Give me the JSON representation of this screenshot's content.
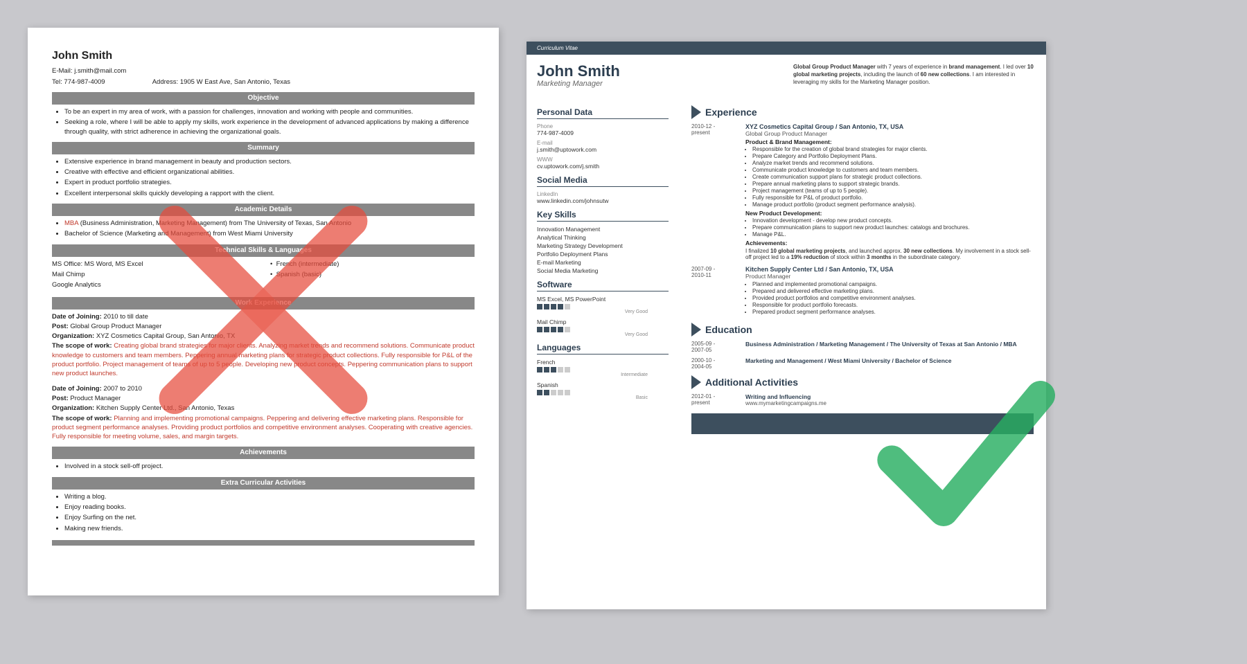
{
  "left_resume": {
    "name": "John Smith",
    "email": "E-Mail: j.smith@mail.com",
    "tel": "Tel: 774-987-4009",
    "address": "Address: 1905 W East Ave, San Antonio, Texas",
    "objective_header": "Objective",
    "objective_items": [
      "To be an expert in my area of work, with a passion for challenges, innovation and working with people and communities.",
      "Seeking a role, where I will be able to apply my skills, work experience in the development of advanced applications by making a difference through quality, with strict adherence in achieving the organizational goals."
    ],
    "summary_header": "Summary",
    "summary_items": [
      "Extensive experience in brand management in beauty and production sectors.",
      "Creative with effective and efficient organizational abilities.",
      "Expert in product portfolio strategies.",
      "Excellent interpersonal skills quickly developing a rapport with the client."
    ],
    "academic_header": "Academic Details",
    "academic_items": [
      "MBA (Business Administration, Marketing Management) from The University of Texas, San Antonio",
      "Bachelor of Science (Marketing and Management) from West Miami University"
    ],
    "technical_header": "Technical Skills & Languages",
    "technical_items": [
      "MS Office: MS Word, MS Excel",
      "Mail Chimp",
      "Google Analytics"
    ],
    "lang_items": [
      "French (intermediate)",
      "Spanish (basic)"
    ],
    "work_header": "Work Experience",
    "work_entries": [
      {
        "date": "Date of Joining: 2010 to till date",
        "post": "Post: Global Group Product Manager",
        "org": "Organization: XYZ Cosmetics Capital Group, San Antonio, TX",
        "scope": "The scope of work: Creating global brand strategies for major clients. Analyzing market trends and recommend solutions. Communicate product knowledge to customers and team members. Peppering annual marketing plans for strategic product collections. Fully responsible for P&L of the product portfolio. Project management of teams of up to 5 people. Developing new product concepts. Peppering communication plans to support new product launches."
      },
      {
        "date": "Date of Joining: 2007 to 2010",
        "post": "Post: Product Manager",
        "org": "Organization: Kitchen Supply Center Ltd., San Antonio, Texas",
        "scope": "The scope of work: Planning and implementing promotional campaigns. Peppering and delivering effective marketing plans. Responsible for product segment performance analyses. Providing product portfolios and competitive environment analyses. Cooperating with creative agencies. Fully responsible for meeting volume, sales, and margin targets."
      }
    ],
    "achievements_header": "Achievements",
    "achievements_items": [
      "Involved in a stock sell-off project."
    ],
    "extra_header": "Extra Curricular Activities",
    "extra_items": [
      "Writing a blog.",
      "Enjoy reading books.",
      "Enjoy Surfing on the net.",
      "Making new friends."
    ]
  },
  "right_resume": {
    "cv_label": "Curriculum Vitae",
    "name": "John Smith",
    "subtitle": "Marketing Manager",
    "summary": "Global Group Product Manager with 7 years of experience in brand management. I led over 10 global marketing projects, including the launch of 60 new collections. I am interested in leveraging my skills for the Marketing Manager position.",
    "personal_data_title": "Personal Data",
    "phone_label": "Phone",
    "phone": "774-987-4009",
    "email_label": "E-mail",
    "email": "j.smith@uptowork.com",
    "www_label": "WWW",
    "www": "cv.uptowork.com/j.smith",
    "social_title": "Social Media",
    "linkedin_label": "LinkedIn",
    "linkedin": "www.linkedin.com/johnsutw",
    "skills_title": "Key Skills",
    "skills": [
      "Innovation Management",
      "Analytical Thinking",
      "Marketing Strategy Development",
      "Portfolio Deployment Plans",
      "E-mail Marketing",
      "Social Media Marketing"
    ],
    "software_title": "Software",
    "software_items": [
      {
        "name": "MS Excel, MS PowerPoint",
        "dots": 4,
        "total": 5,
        "label": "Very Good"
      },
      {
        "name": "Mail Chimp",
        "dots": 4,
        "total": 5,
        "label": "Very Good"
      }
    ],
    "languages_title": "Languages",
    "languages": [
      {
        "name": "French",
        "dots": 3,
        "total": 5,
        "label": "Intermediate"
      },
      {
        "name": "Spanish",
        "dots": 2,
        "total": 5,
        "label": "Basic"
      }
    ],
    "experience_title": "Experience",
    "experience": [
      {
        "date": "2010-12 - present",
        "company": "XYZ Cosmetics Capital Group / San Antonio, TX, USA",
        "title": "Global Group Product Manager",
        "section1": "Product & Brand Management:",
        "bullets1": [
          "Responsible for the creation of global brand strategies for major clients.",
          "Prepare Category and Portfolio Deployment Plans.",
          "Analyze market trends and recommend solutions.",
          "Communicate product knowledge to customers and team members.",
          "Create communication support plans for strategic product collections.",
          "Prepare annual marketing plans to support strategic brands.",
          "Project management (teams of up to 5 people).",
          "Fully responsible for P&L of product portfolio.",
          "Manage product portfolio (product segment performance analysis)."
        ],
        "section2": "New Product Development:",
        "bullets2": [
          "Innovation development - develop new product concepts.",
          "Prepare communication plans to support new product launches: catalogs and brochures.",
          "Manage P&L."
        ],
        "section3": "Achievements:",
        "achieve": "I finalized 10 global marketing projects, and launched approx. 30 new collections. My involvement in a stock sell-off project led to a 19% reduction of stock within 3 months in the subordinate category."
      },
      {
        "date": "2007-09 - 2010-11",
        "company": "Kitchen Supply Center Ltd / San Antonio, TX, USA",
        "title": "Product Manager",
        "bullets1": [
          "Planned and implemented promotional campaigns.",
          "Prepared and delivered effective marketing plans.",
          "Provided product portfolios and competitive environment analyses.",
          "Responsible for product portfolio forecasts.",
          "Prepared product segment performance analyses."
        ]
      }
    ],
    "education_title": "Education",
    "education": [
      {
        "date": "2005-09 - 2007-05",
        "title": "Business Administration / Marketing Management / The University of Texas at San Antonio / MBA"
      },
      {
        "date": "2000-10 - 2004-05",
        "title": "Marketing and Management / West Miami University / Bachelor of Science"
      }
    ],
    "activities_title": "Additional Activities",
    "activities": [
      {
        "date": "2012-01 - present",
        "title": "Writing and Influencing",
        "url": "www.mymarketingcampaigns.me"
      }
    ]
  }
}
